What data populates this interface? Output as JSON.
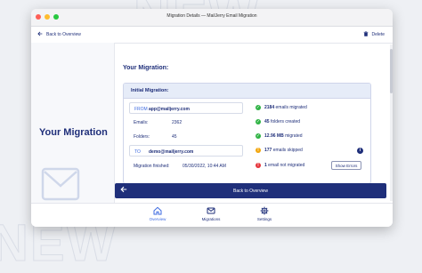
{
  "window": {
    "title": "Migration Details — MailJerry Email Migration"
  },
  "toolbar": {
    "back_label": "Back to Overview",
    "delete_label": "Delete"
  },
  "left_panel": {
    "title": "Your Migration"
  },
  "main": {
    "section_title": "Your Migration:",
    "card_title": "Initial Migration:",
    "from": {
      "label": "FROM",
      "value": "app@mailjerry.com"
    },
    "emails": {
      "label": "Emails:",
      "value": "2362"
    },
    "folders": {
      "label": "Folders:",
      "value": "45"
    },
    "to": {
      "label": "TO",
      "value": "demo@mailjerry.com"
    },
    "finished": {
      "label": "Migration finished:",
      "value": "05/30/2022, 10:44 AM"
    },
    "statuses": [
      {
        "icon": "check-circle-icon",
        "color": "#2fb344",
        "strong": "2184",
        "text": "emails migrated"
      },
      {
        "icon": "check-circle-icon",
        "color": "#2fb344",
        "strong": "45",
        "text": "folders created"
      },
      {
        "icon": "check-circle-icon",
        "color": "#2fb344",
        "strong": "12.96 MB",
        "text": "migrated"
      },
      {
        "icon": "warning-circle-icon",
        "color": "#f2a60d",
        "strong": "177",
        "text": "emails skipped"
      },
      {
        "icon": "error-circle-icon",
        "color": "#e5343a",
        "strong": "1",
        "text": "email not migrated"
      }
    ],
    "show_errors_label": "Show Errors",
    "back_bar_label": "Back to Overview"
  },
  "bottom_nav": [
    {
      "label": "Overview",
      "icon": "home-icon",
      "active": true
    },
    {
      "label": "Migrations",
      "icon": "mail-icon",
      "active": false
    },
    {
      "label": "Settings",
      "icon": "gear-icon",
      "active": false
    }
  ],
  "colors": {
    "accent": "#1f2f7a",
    "link": "#3d6ae0",
    "success": "#2fb344",
    "warning": "#f2a60d",
    "error": "#e5343a"
  }
}
